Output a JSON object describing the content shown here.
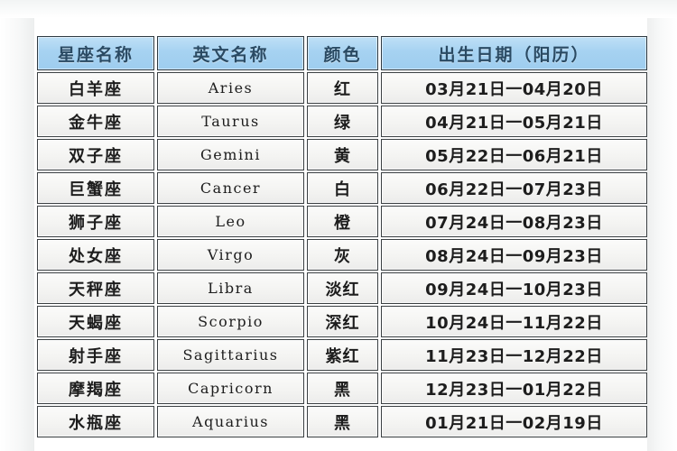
{
  "document": {
    "title": "星座名称英文名称颜色出生日期对照表",
    "top_partial_text": "· · · · ·   · ·    · · ·"
  },
  "colors": {
    "header_blue": "#a6d2f1",
    "header_text": "#2a4a63",
    "cell_background": "#f4f4f2",
    "border": "#3a3f42",
    "page_background": "#ffffff"
  },
  "table": {
    "columns": [
      {
        "key": "name",
        "label": "星座名称"
      },
      {
        "key": "en",
        "label": "英文名称"
      },
      {
        "key": "color",
        "label": "颜色"
      },
      {
        "key": "date",
        "label": "出生日期（阳历）"
      }
    ],
    "rows": [
      {
        "name": "白羊座",
        "en": "Aries",
        "color": "红",
        "date": "03月21日一04月20日"
      },
      {
        "name": "金牛座",
        "en": "Taurus",
        "color": "绿",
        "date": "04月21日一05月21日"
      },
      {
        "name": "双子座",
        "en": "Gemini",
        "color": "黄",
        "date": "05月22日一06月21日"
      },
      {
        "name": "巨蟹座",
        "en": "Cancer",
        "color": "白",
        "date": "06月22日一07月23日"
      },
      {
        "name": "狮子座",
        "en": "Leo",
        "color": "橙",
        "date": "07月24日一08月23日"
      },
      {
        "name": "处女座",
        "en": "Virgo",
        "color": "灰",
        "date": "08月24日一09月23日"
      },
      {
        "name": "天秤座",
        "en": "Libra",
        "color": "淡红",
        "date": "09月24日一10月23日"
      },
      {
        "name": "天蝎座",
        "en": "Scorpio",
        "color": "深红",
        "date": "10月24日一11月22日"
      },
      {
        "name": "射手座",
        "en": "Sagittarius",
        "color": "紫红",
        "date": "11月23日一12月22日"
      },
      {
        "name": "摩羯座",
        "en": "Capricorn",
        "color": "黑",
        "date": "12月23日一01月22日"
      },
      {
        "name": "水瓶座",
        "en": "Aquarius",
        "color": "黑",
        "date": "01月21日一02月19日"
      }
    ]
  }
}
